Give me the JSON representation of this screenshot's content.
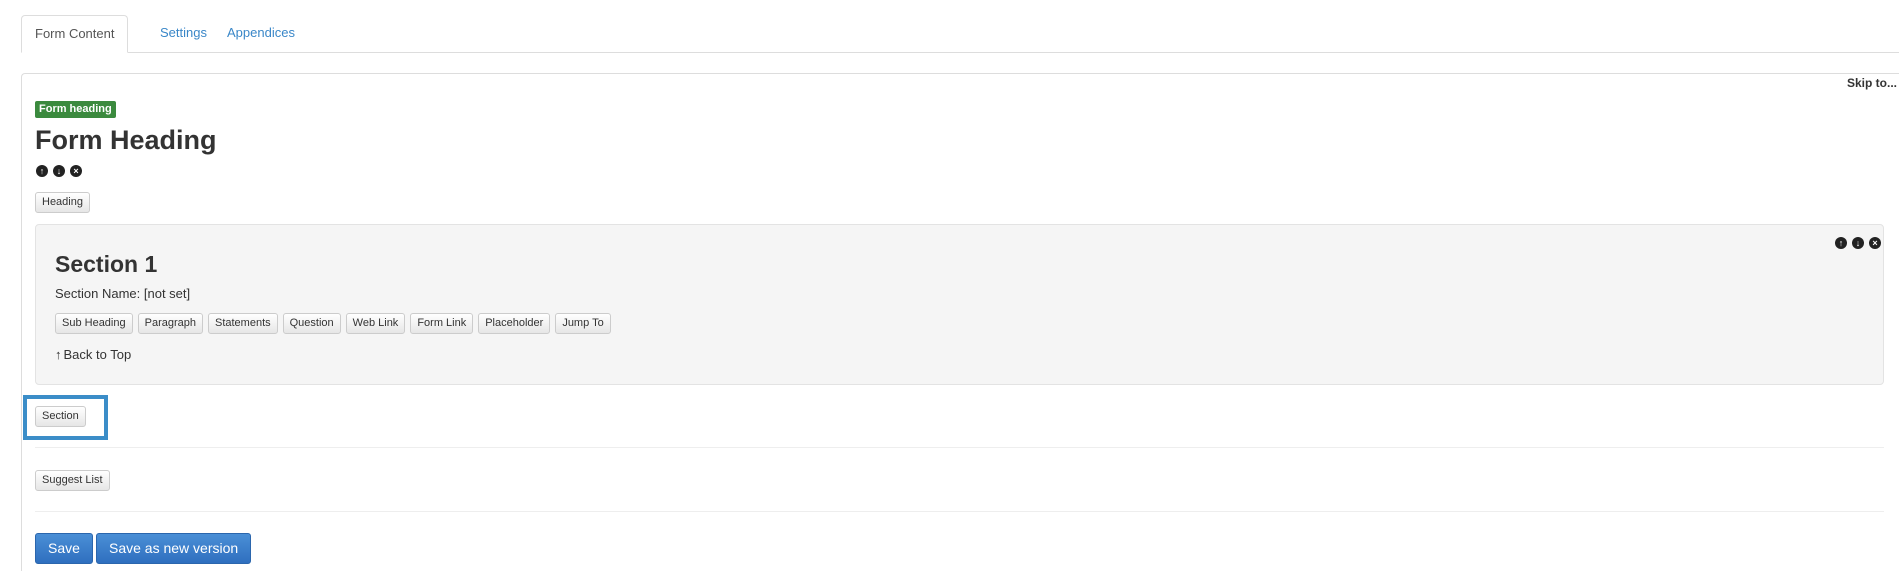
{
  "tabs": [
    {
      "label": "Form Content",
      "active": true
    },
    {
      "label": "Settings",
      "active": false
    },
    {
      "label": "Appendices",
      "active": false
    }
  ],
  "skip_to": "Skip to...",
  "form": {
    "badge": "Form heading",
    "heading": "Form Heading",
    "heading_button": "Heading"
  },
  "section": {
    "title": "Section 1",
    "name_text": "Section Name: [not set]",
    "buttons": [
      "Sub Heading",
      "Paragraph",
      "Statements",
      "Question",
      "Web Link",
      "Form Link",
      "Placeholder",
      "Jump To"
    ],
    "back_to_top": "Back to Top"
  },
  "section_button": "Section",
  "suggest_list_button": "Suggest List",
  "actions": {
    "save": "Save",
    "save_new_version": "Save as new version"
  },
  "icons": {
    "move_up": "arrow-up-circle-icon",
    "move_down": "arrow-down-circle-icon",
    "remove": "remove-circle-icon",
    "back_to_top": "arrow-up-icon"
  },
  "colors": {
    "link": "#3a87c8",
    "badge": "#3b8a3e",
    "primary": "#337ab7",
    "highlight": "#3b8dc8"
  }
}
